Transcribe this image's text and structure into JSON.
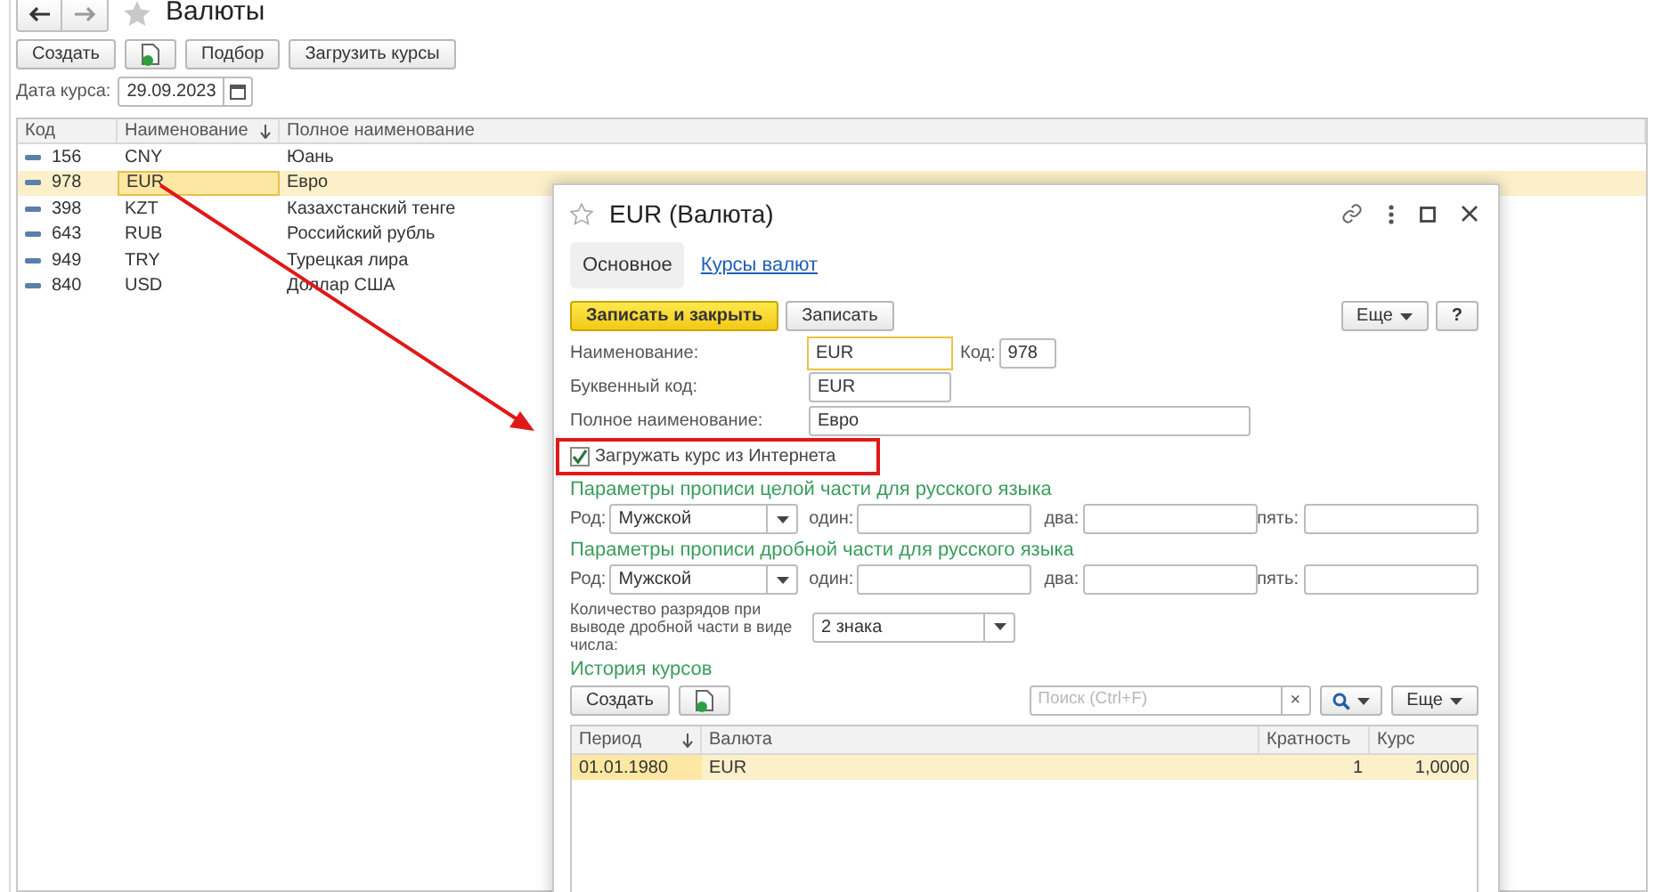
{
  "page": {
    "title": "Валюты"
  },
  "toolbar": {
    "create": "Создать",
    "pick": "Подбор",
    "load": "Загрузить курсы"
  },
  "date_filter": {
    "label": "Дата курса:",
    "value": "29.09.2023"
  },
  "list": {
    "columns": [
      "Код",
      "Наименование",
      "Полное наименование"
    ],
    "rows": [
      {
        "code": "156",
        "name": "CNY",
        "full_name": "Юань",
        "selected": false
      },
      {
        "code": "978",
        "name": "EUR",
        "full_name": "Евро",
        "selected": true
      },
      {
        "code": "398",
        "name": "KZT",
        "full_name": "Казахстанский тенге",
        "selected": false
      },
      {
        "code": "643",
        "name": "RUB",
        "full_name": "Российский рубль",
        "selected": false
      },
      {
        "code": "949",
        "name": "TRY",
        "full_name": "Турецкая лира",
        "selected": false
      },
      {
        "code": "840",
        "name": "USD",
        "full_name": "Доллар США",
        "selected": false
      }
    ]
  },
  "dialog": {
    "title": "EUR (Валюта)",
    "tabs": [
      {
        "label": "Основное",
        "selected": true
      },
      {
        "label": "Курсы валют",
        "selected": false
      }
    ],
    "save_close": "Записать и закрыть",
    "save": "Записать",
    "more": "Еще",
    "help": "?",
    "name": {
      "label": "Наименование:",
      "value": "EUR"
    },
    "code": {
      "label": "Код:",
      "value": "978"
    },
    "letter_code": {
      "label": "Буквенный код:",
      "value": "EUR"
    },
    "full_name": {
      "label": "Полное наименование:",
      "value": "Евро"
    },
    "load_checkbox": {
      "label": "Загружать курс из Интернета",
      "checked": true
    },
    "sections": [
      {
        "heading": "Параметры прописи целой части для русского языка",
        "gender_label": "Род:",
        "gender": "Мужской",
        "one": "один:",
        "two": "два:",
        "five": "пять:"
      },
      {
        "heading": "Параметры прописи дробной части для русского языка",
        "gender_label": "Род:",
        "gender": "Мужской",
        "one": "один:",
        "two": "два:",
        "five": "пять:"
      }
    ],
    "digits": {
      "label": "Количество разрядов при выводе дробной части в виде числа:",
      "value": "2 знака"
    },
    "history": {
      "heading": "История курсов",
      "create": "Создать",
      "search_placeholder": "Поиск (Ctrl+F)",
      "clear": "×",
      "more": "Еще",
      "columns": [
        "Период",
        "Валюта",
        "Кратность",
        "Курс"
      ],
      "rows": [
        {
          "period": "01.01.1980",
          "currency": "EUR",
          "multiplicity": "1",
          "rate": "1,0000",
          "selected": true
        }
      ]
    }
  }
}
